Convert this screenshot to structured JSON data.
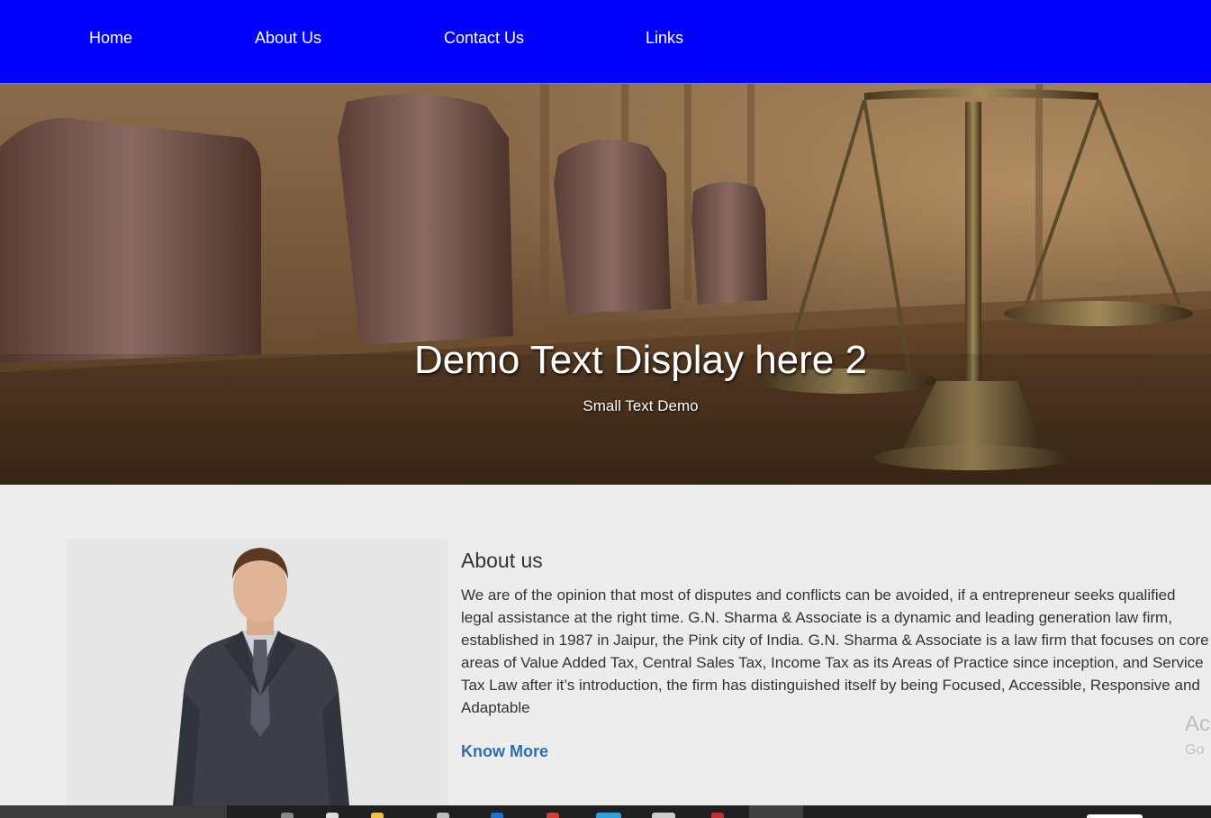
{
  "nav": {
    "items": [
      {
        "label": "Home"
      },
      {
        "label": "About Us"
      },
      {
        "label": "Contact Us"
      },
      {
        "label": "Links"
      }
    ]
  },
  "hero": {
    "title": "Demo Text Display here 2",
    "subtitle": "Small Text Demo"
  },
  "about": {
    "heading": "About us",
    "body": "We are of the opinion that most of disputes and conflicts can be avoided, if a entrepreneur seeks qualified legal assistance at the right time. G.N. Sharma & Associate is a dynamic and leading generation law firm, established in 1987 in Jaipur, the Pink city of India. G.N. Sharma & Associate is a law firm that focuses on core areas of Value Added Tax, Central Sales Tax, Income Tax as its Areas of Practice since inception, and Service Tax Law after it’s introduction, the firm has distinguished itself by being Focused, Accessible, Responsive and Adaptable",
    "link_label": "Know More"
  },
  "watermark": {
    "line1": "Ac",
    "line2": "Go"
  },
  "colors": {
    "navbar": "#0000ff",
    "link": "#2c6fb0",
    "content_bg": "#ededed"
  }
}
